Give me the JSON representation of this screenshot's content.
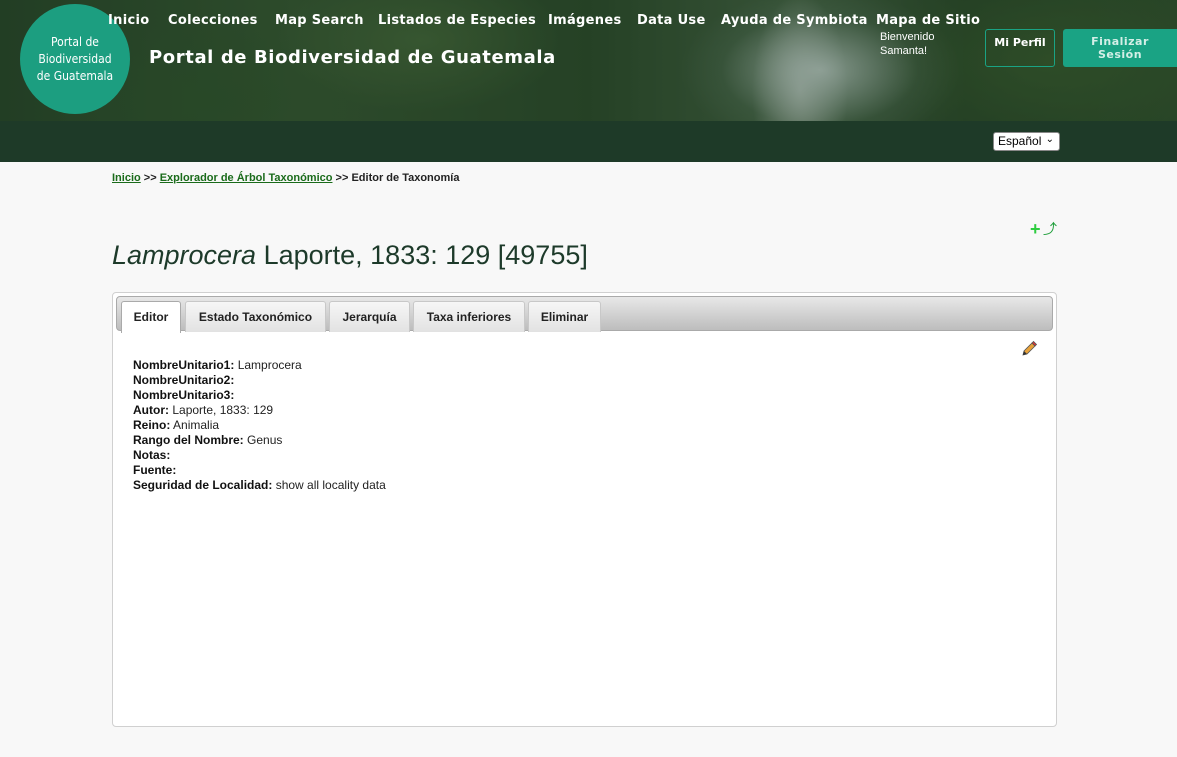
{
  "header": {
    "logo_text": "Portal de Biodiversidad de Guatemala",
    "site_title": "Portal de Biodiversidad de Guatemala",
    "welcome_line1": "Bienvenido",
    "welcome_line2": "Samanta!",
    "profile_button": "Mi Perfil",
    "logout_button": "Finalizar Sesión"
  },
  "nav": {
    "items": [
      "Inicio",
      "Colecciones",
      "Map Search",
      "Listados de Especies",
      "Imágenes",
      "Data Use",
      "Ayuda de Symbiota",
      "Mapa de Sitio"
    ],
    "language": "Español"
  },
  "breadcrumb": {
    "home": "Inicio",
    "sep1": ">>",
    "explorer": "Explorador de Árbol Taxonómico",
    "sep2": ">>",
    "current": "Editor de Taxonomía"
  },
  "taxon": {
    "name_italic": "Lamprocera",
    "rest": " Laporte, 1833: 129 [49755]"
  },
  "tabs": [
    "Editor",
    "Estado Taxonómico",
    "Jerarquía",
    "Taxa inferiores",
    "Eliminar"
  ],
  "fields": [
    {
      "label": "NombreUnitario1:",
      "value": "Lamprocera"
    },
    {
      "label": "NombreUnitario2:",
      "value": ""
    },
    {
      "label": "NombreUnitario3:",
      "value": ""
    },
    {
      "label": "Autor:",
      "value": "Laporte, 1833: 129"
    },
    {
      "label": "Reino:",
      "value": "Animalia"
    },
    {
      "label": "Rango del Nombre:",
      "value": "Genus"
    },
    {
      "label": "Notas:",
      "value": ""
    },
    {
      "label": "Fuente:",
      "value": ""
    },
    {
      "label": "Seguridad de Localidad:",
      "value": "show all locality data"
    }
  ],
  "icons": {
    "add": "plus-icon",
    "up": "arrow-up-icon",
    "edit": "pencil-icon"
  }
}
